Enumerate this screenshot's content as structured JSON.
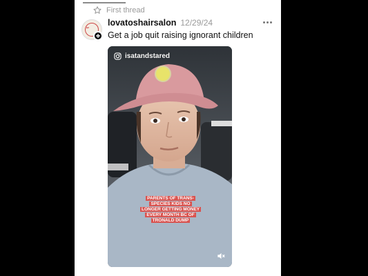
{
  "thread": {
    "label": "First thread",
    "star_icon": "star-icon"
  },
  "post": {
    "username": "lovatoshairsalon",
    "date": "12/29/24",
    "text": "Get a job quit raising ignorant children",
    "more_icon": "more-horizontal-icon"
  },
  "video": {
    "instagram_handle": "isatandstared",
    "caption": "PARENTS OF TRANS-SPECIES KIDS NO LONGER GETTING MONEY EVERY MONTH BC OF TRONALD DUMP",
    "mute_icon": "speaker-muted-icon"
  },
  "colors": {
    "caption_bg": "#d9534f",
    "cap": "#d99a9e",
    "shirt": "#a9b7c6"
  }
}
